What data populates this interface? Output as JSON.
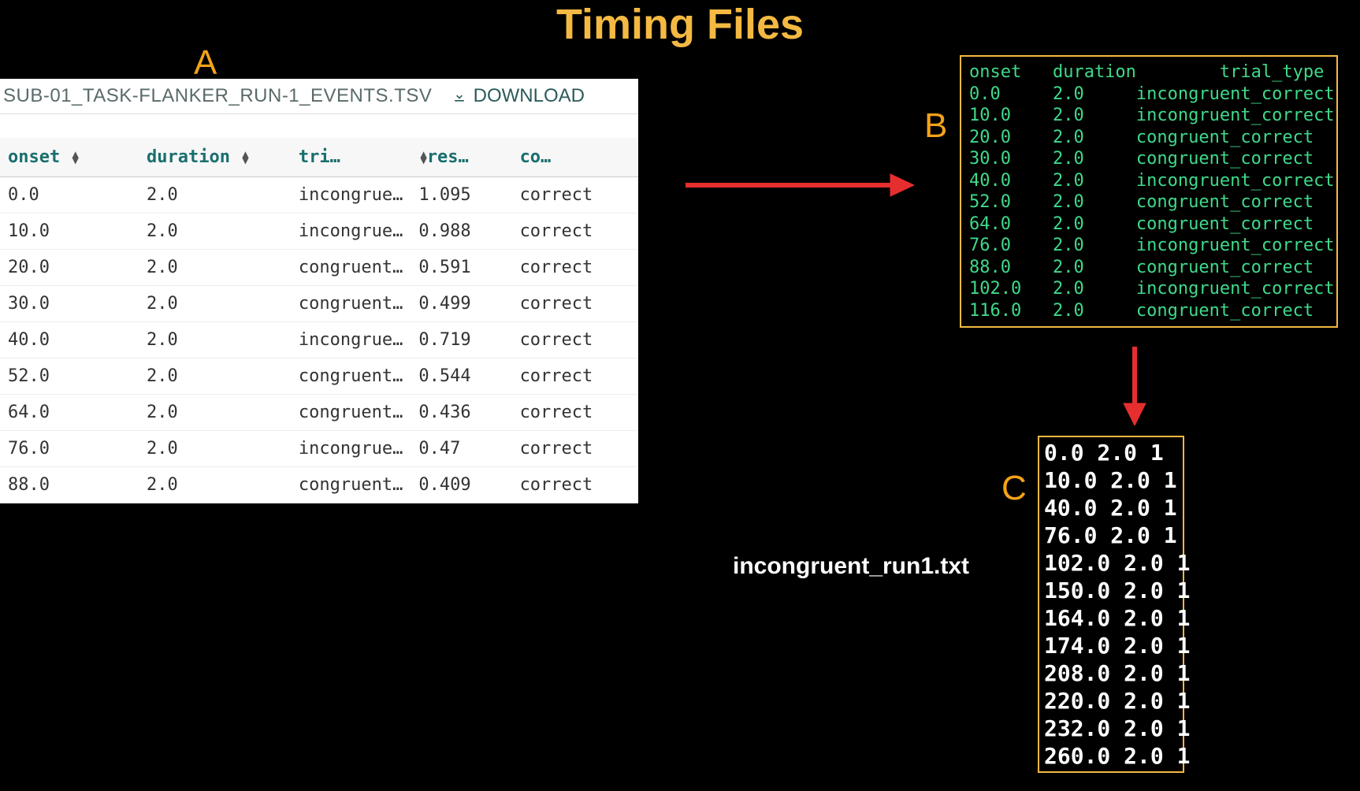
{
  "title": "Timing Files",
  "labels": {
    "a": "A",
    "b": "B",
    "c": "C"
  },
  "panelA": {
    "filename": "SUB-01_TASK-FLANKER_RUN-1_EVENTS.TSV",
    "download": "DOWNLOAD",
    "columns": [
      "onset",
      "duration",
      "tri…",
      "res…",
      "co…"
    ],
    "rows": [
      {
        "onset": "0.0",
        "duration": "2.0",
        "trial": "incongrue…",
        "res": "1.095",
        "cor": "correct"
      },
      {
        "onset": "10.0",
        "duration": "2.0",
        "trial": "incongrue…",
        "res": "0.988",
        "cor": "correct"
      },
      {
        "onset": "20.0",
        "duration": "2.0",
        "trial": "congruent…",
        "res": "0.591",
        "cor": "correct"
      },
      {
        "onset": "30.0",
        "duration": "2.0",
        "trial": "congruent…",
        "res": "0.499",
        "cor": "correct"
      },
      {
        "onset": "40.0",
        "duration": "2.0",
        "trial": "incongrue…",
        "res": "0.719",
        "cor": "correct"
      },
      {
        "onset": "52.0",
        "duration": "2.0",
        "trial": "congruent…",
        "res": "0.544",
        "cor": "correct"
      },
      {
        "onset": "64.0",
        "duration": "2.0",
        "trial": "congruent…",
        "res": "0.436",
        "cor": "correct"
      },
      {
        "onset": "76.0",
        "duration": "2.0",
        "trial": "incongrue…",
        "res": "0.47",
        "cor": "correct"
      },
      {
        "onset": "88.0",
        "duration": "2.0",
        "trial": "congruent…",
        "res": "0.409",
        "cor": "correct"
      }
    ]
  },
  "panelB": {
    "header": {
      "c1": "onset",
      "c2": "duration",
      "c3": "trial_type"
    },
    "rows": [
      {
        "onset": "0.0",
        "duration": "2.0",
        "trial": "incongruent_correct"
      },
      {
        "onset": "10.0",
        "duration": "2.0",
        "trial": "incongruent_correct"
      },
      {
        "onset": "20.0",
        "duration": "2.0",
        "trial": "congruent_correct"
      },
      {
        "onset": "30.0",
        "duration": "2.0",
        "trial": "congruent_correct"
      },
      {
        "onset": "40.0",
        "duration": "2.0",
        "trial": "incongruent_correct"
      },
      {
        "onset": "52.0",
        "duration": "2.0",
        "trial": "congruent_correct"
      },
      {
        "onset": "64.0",
        "duration": "2.0",
        "trial": "congruent_correct"
      },
      {
        "onset": "76.0",
        "duration": "2.0",
        "trial": "incongruent_correct"
      },
      {
        "onset": "88.0",
        "duration": "2.0",
        "trial": "congruent_correct"
      },
      {
        "onset": "102.0",
        "duration": "2.0",
        "trial": "incongruent_correct"
      },
      {
        "onset": "116.0",
        "duration": "2.0",
        "trial": "congruent_correct"
      }
    ]
  },
  "panelC": {
    "filename": "incongruent_run1.txt",
    "rows": [
      "0.0 2.0 1",
      "10.0 2.0 1",
      "40.0 2.0 1",
      "76.0 2.0 1",
      "102.0 2.0 1",
      "150.0 2.0 1",
      "164.0 2.0 1",
      "174.0 2.0 1",
      "208.0 2.0 1",
      "220.0 2.0 1",
      "232.0 2.0 1",
      "260.0 2.0 1"
    ]
  }
}
